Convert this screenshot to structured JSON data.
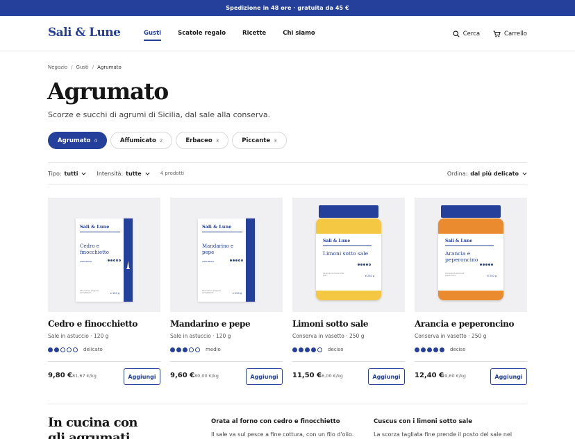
{
  "promo": {
    "text": "Spedizione in 48 ore · gratuita da 45 €"
  },
  "header": {
    "logo": "Sali & Lune",
    "nav": [
      {
        "label": "Gusti",
        "active": true
      },
      {
        "label": "Scatole regalo",
        "active": false
      },
      {
        "label": "Ricette",
        "active": false
      },
      {
        "label": "Chi siamo",
        "active": false
      }
    ],
    "search_label": "Cerca",
    "cart_label": "Carrello"
  },
  "breadcrumb": [
    "Negozio",
    "Gusti",
    "Agrumato"
  ],
  "page": {
    "title": "Agrumato",
    "subtitle": "Scorze e succhi di agrumi di Sicilia, dal sale alla conserva."
  },
  "chips": [
    {
      "label": "Agrumato",
      "count": "4",
      "active": true
    },
    {
      "label": "Affumicato",
      "count": "2",
      "active": false
    },
    {
      "label": "Erbaceo",
      "count": "3",
      "active": false
    },
    {
      "label": "Piccante",
      "count": "3",
      "active": false
    }
  ],
  "filters": {
    "type_label": "Tipo:",
    "type_value": "tutti",
    "intensity_label": "Intensità:",
    "intensity_value": "tutte",
    "count": "4 prodotti",
    "sort_label": "Ordina:",
    "sort_value": "dal più delicato"
  },
  "products": [
    {
      "name": "Cedro e finocchietto",
      "sub": "Sale in astuccio · 120 g",
      "intensity": 2,
      "intensity_max": 5,
      "intensity_label": "delicato",
      "price": "9,80 €",
      "per_kg": "81,67 €/kg",
      "button": "Aggiungi",
      "pack": {
        "kind": "box",
        "brand": "Sali & Lune",
        "name": "Cedro e finocchietto",
        "line": "AGRUMATO",
        "weight": "e 120 g",
        "fine": "Sale marino integrale aromatizzato"
      }
    },
    {
      "name": "Mandarino e pepe",
      "sub": "Sale in astuccio · 120 g",
      "intensity": 3,
      "intensity_max": 5,
      "intensity_label": "medio",
      "price": "9,60 €",
      "per_kg": "80,00 €/kg",
      "button": "Aggiungi",
      "pack": {
        "kind": "box",
        "brand": "Sali & Lune",
        "name": "Mandarino e pepe",
        "line": "AGRUMATO",
        "weight": "e 120 g",
        "fine": "Sale marino integrale aromatizzato"
      }
    },
    {
      "name": "Limoni sotto sale",
      "sub": "Conserva in vasetto · 250 g",
      "intensity": 4,
      "intensity_max": 5,
      "intensity_label": "deciso",
      "price": "11,50 €",
      "per_kg": "46,00 €/kg",
      "button": "Aggiungi",
      "pack": {
        "kind": "jar",
        "brand": "Sali & Lune",
        "name": "Limoni sotto sale",
        "weight": "e 250 g",
        "fine": "Conserva di limoni sotto sale",
        "band": "#f4c842"
      }
    },
    {
      "name": "Arancia e peperoncino",
      "sub": "Conserva in vasetto · 250 g",
      "intensity": 5,
      "intensity_max": 5,
      "intensity_label": "deciso",
      "price": "12,40 €",
      "per_kg": "49,60 €/kg",
      "button": "Aggiungi",
      "pack": {
        "kind": "jar",
        "brand": "Sali & Lune",
        "name": "Arancia e peperoncino",
        "weight": "e 250 g",
        "fine": "Conserva di arancia e peperoncino",
        "band": "#e98b2e"
      }
    }
  ],
  "cooking": {
    "title": "In cucina con gli agrumati",
    "recipes": [
      {
        "title": "Orata al forno con cedro e finocchietto",
        "desc": "Il sale va sul pesce a fine cottura, con un filo d'olio."
      },
      {
        "title": "Cuscus con i limoni sotto sale",
        "desc": "La scorza tagliata fine prende il posto del sale nel"
      }
    ]
  },
  "colors": {
    "accent": "#25409b",
    "card_bg": "#f0f0f3"
  },
  "icons": {
    "search": "search-icon",
    "cart": "cart-icon",
    "chevron": "chevron-down-icon"
  }
}
